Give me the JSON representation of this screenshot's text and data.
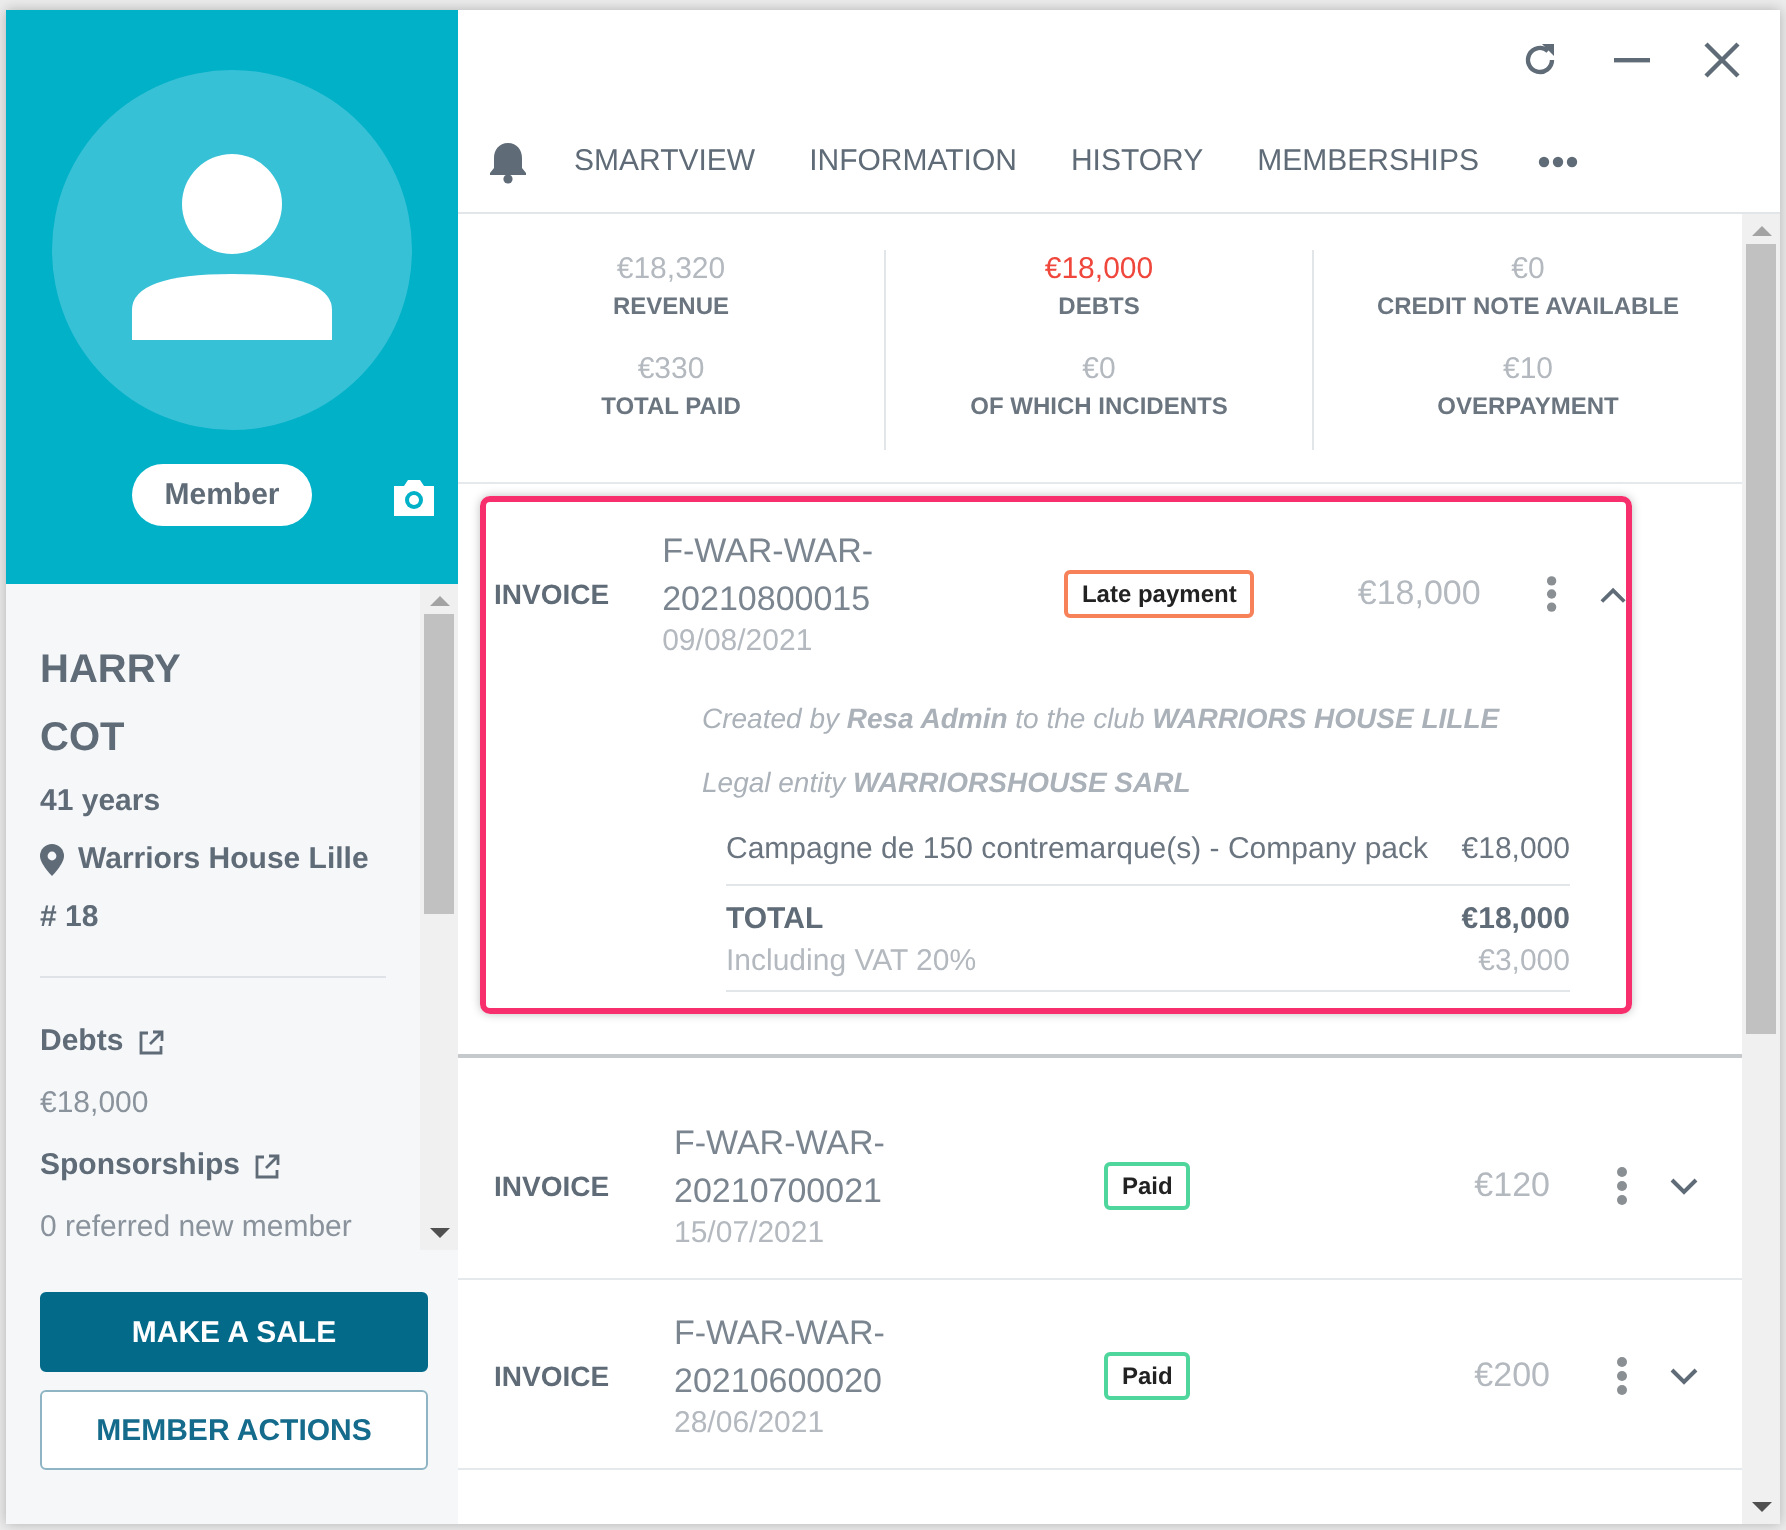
{
  "profile": {
    "badge": "Member",
    "first_name": "HARRY",
    "last_name": "COT",
    "age": "41 years",
    "club": "Warriors House Lille",
    "number": "# 18",
    "sections": [
      {
        "title": "Debts",
        "value": "€18,000"
      },
      {
        "title": "Sponsorships",
        "value": "0 referred new member"
      }
    ],
    "buttons": [
      {
        "label": "MAKE A SALE",
        "kind": "primary"
      },
      {
        "label": "MEMBER ACTIONS",
        "kind": "outline"
      }
    ]
  },
  "tabs": [
    {
      "label": "SMARTVIEW"
    },
    {
      "label": "INFORMATION"
    },
    {
      "label": "HISTORY"
    },
    {
      "label": "MEMBERSHIPS"
    }
  ],
  "stats": [
    {
      "value": "€18,320",
      "label": "REVENUE",
      "kind": "neutral"
    },
    {
      "value": "€18,000",
      "label": "DEBTS",
      "kind": "alert"
    },
    {
      "value": "€0",
      "label": "CREDIT NOTE AVAILABLE",
      "kind": "neutral"
    },
    {
      "value": "€330",
      "label": "TOTAL PAID",
      "kind": "neutral"
    },
    {
      "value": "€0",
      "label": "OF WHICH INCIDENTS",
      "kind": "neutral"
    },
    {
      "value": "€10",
      "label": "OVERPAYMENT",
      "kind": "neutral"
    }
  ],
  "invoices": [
    {
      "type": "INVOICE",
      "number": "F-WAR-WAR-20210800015",
      "date": "09/08/2021",
      "status": {
        "label": "Late payment",
        "kind": "late"
      },
      "amount": "€18,000",
      "expanded": true,
      "highlighted": true,
      "details": {
        "created": "Created by **Resa Admin** to the club **WARRIORS HOUSE LILLE**",
        "legal": "Legal entity **WARRIORSHOUSE SARL**",
        "lines": [
          {
            "description": "Campagne de 150 contremarque(s) - Company pack",
            "amount": "€18,000"
          }
        ],
        "total": {
          "label": "TOTAL",
          "amount": "€18,000"
        },
        "vat": {
          "label": "Including VAT 20%",
          "amount": "€3,000"
        }
      }
    },
    {
      "type": "INVOICE",
      "number": "F-WAR-WAR-20210700021",
      "date": "15/07/2021",
      "status": {
        "label": "Paid",
        "kind": "paid"
      },
      "amount": "€120",
      "expanded": false,
      "highlighted": false
    },
    {
      "type": "INVOICE",
      "number": "F-WAR-WAR-20210600020",
      "date": "28/06/2021",
      "status": {
        "label": "Paid",
        "kind": "paid"
      },
      "amount": "€200",
      "expanded": false,
      "highlighted": false
    }
  ]
}
